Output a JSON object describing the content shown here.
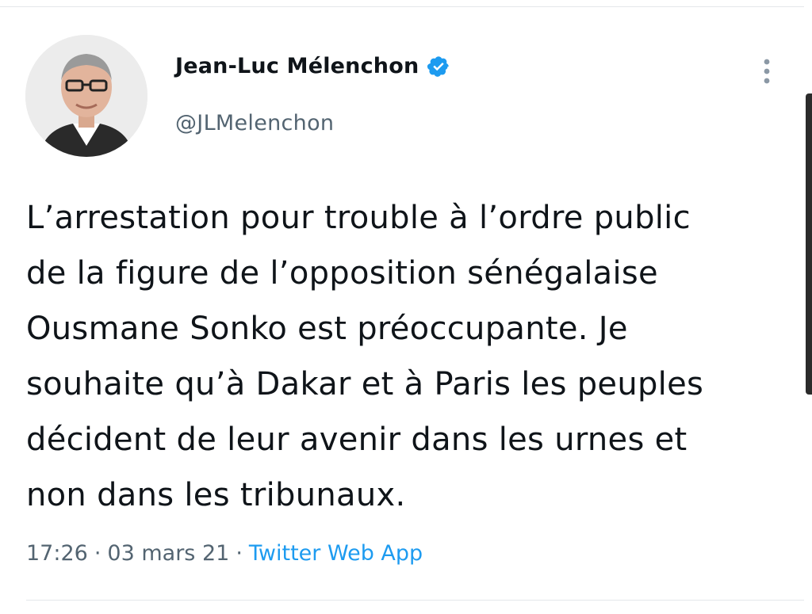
{
  "author": {
    "display_name": "Jean-Luc Mélenchon",
    "handle": "@JLMelenchon",
    "verified": true
  },
  "tweet": {
    "lines": [
      "L’arrestation pour trouble à l’ordre public",
      "de la figure de l’opposition sénégalaise",
      "Ousmane Sonko est préoccupante. Je",
      "souhaite qu’à Dakar et à Paris les peuples",
      "décident de leur avenir dans les urnes et",
      "non dans les tribunaux."
    ],
    "time": "17:26",
    "date": "03 mars 21",
    "separator": "·",
    "source": "Twitter Web App"
  },
  "icons": {
    "verified": "verified-badge-icon",
    "more": "more-vertical-icon"
  },
  "colors": {
    "accent": "#1d9bf0",
    "secondary_text": "#536471",
    "primary_text": "#0f1419"
  }
}
